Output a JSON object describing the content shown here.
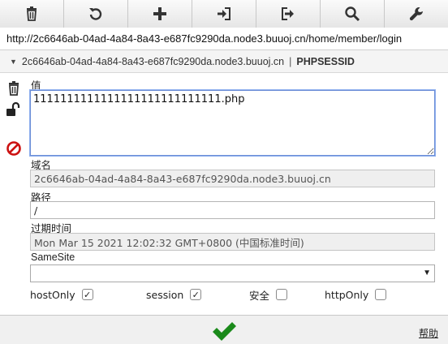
{
  "toolbar": {
    "icons": [
      "trash-icon",
      "refresh-icon",
      "plus-icon",
      "import-icon",
      "export-icon",
      "search-icon",
      "wrench-icon"
    ]
  },
  "url": "http://2c6646ab-04ad-4a84-8a43-e687fc9290da.node3.buuoj.cn/home/member/login",
  "cookie": {
    "domain": "2c6646ab-04ad-4a84-8a43-e687fc9290da.node3.buuoj.cn",
    "separator": "|",
    "name": "PHPSESSID"
  },
  "form": {
    "value_label": "值",
    "value": "1111111111111111111111111111.php",
    "domain_label": "域名",
    "domain": "2c6646ab-04ad-4a84-8a43-e687fc9290da.node3.buuoj.cn",
    "path_label": "路径",
    "path": "/",
    "expires_label": "过期时间",
    "expires": "Mon Mar 15 2021 12:02:32 GMT+0800 (中国标准时间)",
    "samesite_label": "SameSite",
    "samesite_value": ""
  },
  "flags": {
    "hostonly_label": "hostOnly",
    "hostonly_checked": true,
    "session_label": "session",
    "session_checked": true,
    "secure_label": "安全",
    "secure_checked": false,
    "httponly_label": "httpOnly",
    "httponly_checked": false
  },
  "footer": {
    "help_label": "帮助"
  },
  "colors": {
    "accent_green": "#1a8a1a",
    "delete_red": "#cc1111"
  }
}
